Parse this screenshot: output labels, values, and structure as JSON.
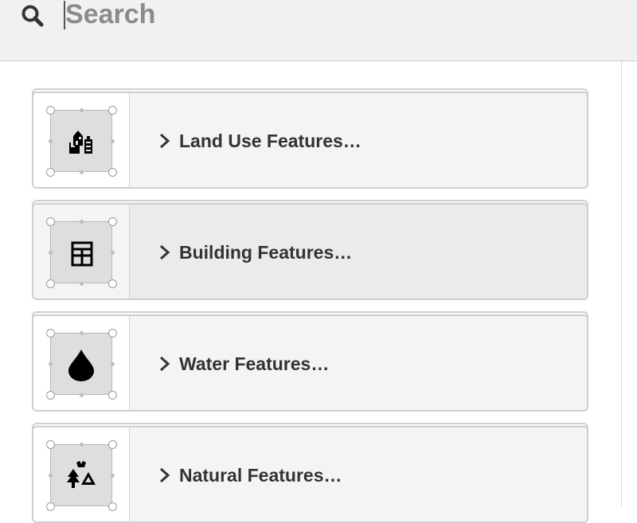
{
  "search": {
    "placeholder": "Search",
    "value": "",
    "icon": "search-icon"
  },
  "presets": [
    {
      "label": "Land Use Features…",
      "icon": "land-use-icon",
      "expand_icon": "chevron-right-icon",
      "highlighted": false
    },
    {
      "label": "Building Features…",
      "icon": "building-icon",
      "expand_icon": "chevron-right-icon",
      "highlighted": true
    },
    {
      "label": "Water Features…",
      "icon": "water-drop-icon",
      "expand_icon": "chevron-right-icon",
      "highlighted": false
    },
    {
      "label": "Natural Features…",
      "icon": "natural-features-icon",
      "expand_icon": "chevron-right-icon",
      "highlighted": false
    }
  ],
  "colors": {
    "header_bg": "#f1f1f1",
    "card_bg": "#f4f4f4",
    "card_highlight_bg": "#ebebeb",
    "text": "#333333",
    "placeholder": "#8b8b8b"
  }
}
